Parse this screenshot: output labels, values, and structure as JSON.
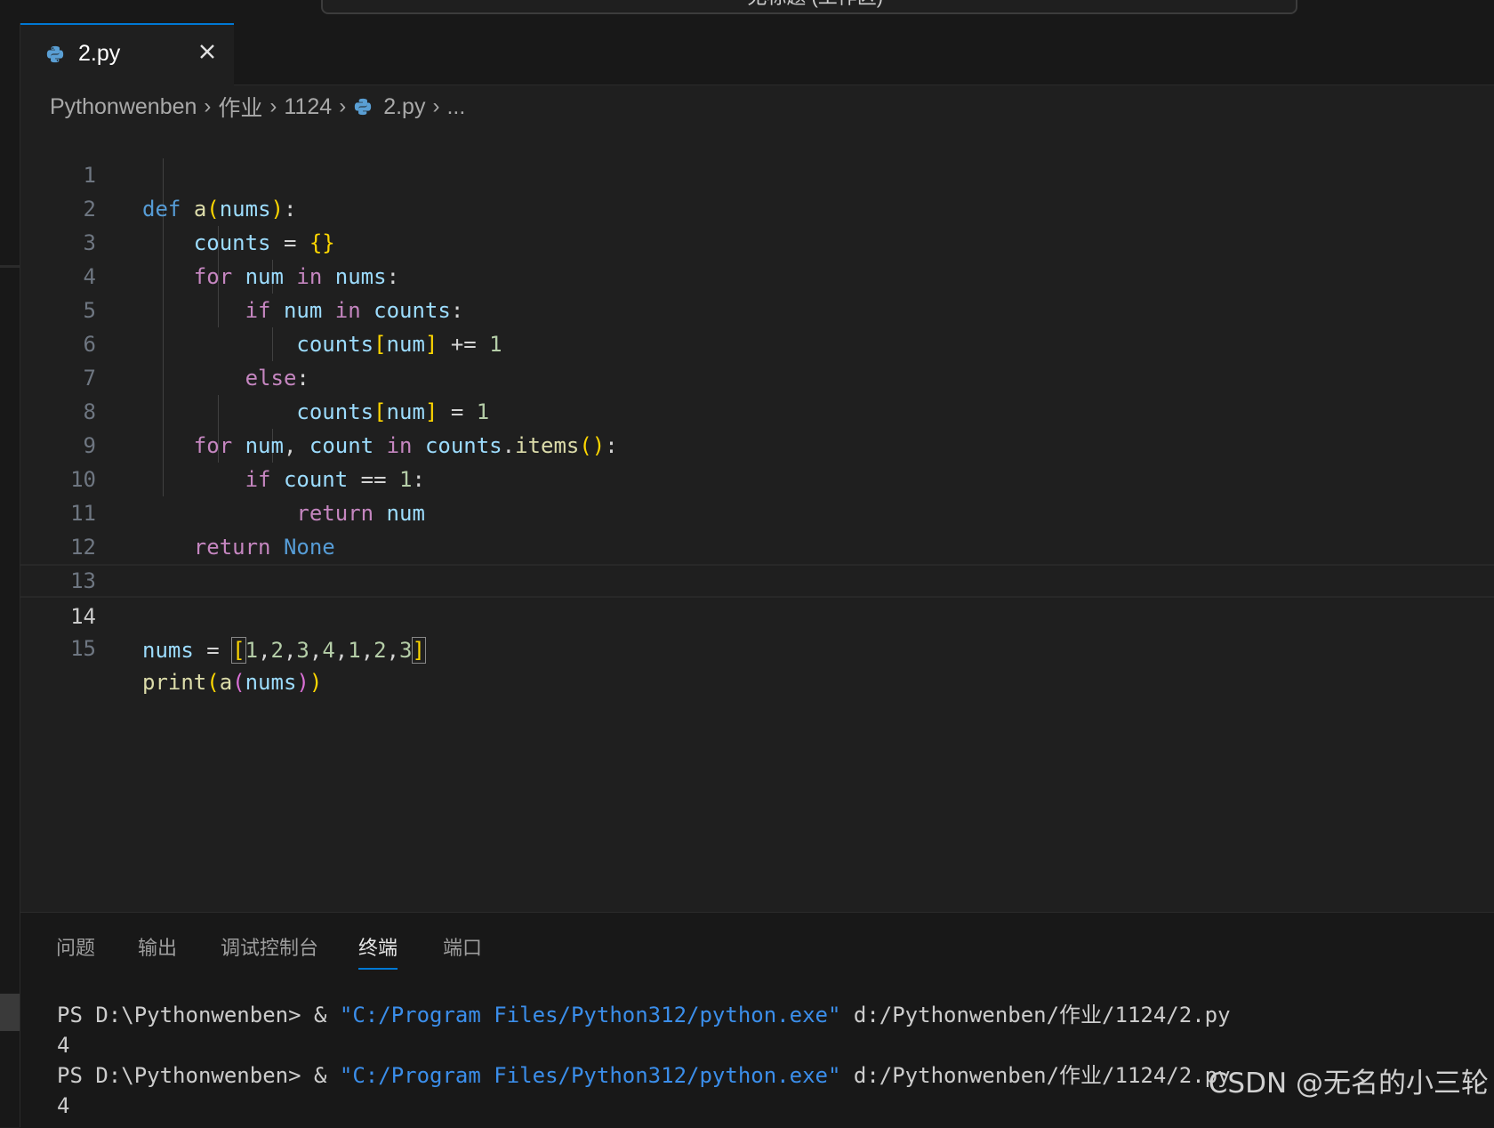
{
  "title_bar": {
    "text": "- 无标题 (工作区)"
  },
  "tab": {
    "label": "2.py"
  },
  "breadcrumb": {
    "items": [
      "Pythonwenben",
      "作业",
      "1124",
      "2.py",
      "..."
    ]
  },
  "editor": {
    "active_line": 14,
    "lines": [
      {
        "n": "1"
      },
      {
        "n": "2"
      },
      {
        "n": "3"
      },
      {
        "n": "4"
      },
      {
        "n": "5"
      },
      {
        "n": "6"
      },
      {
        "n": "7"
      },
      {
        "n": "8"
      },
      {
        "n": "9"
      },
      {
        "n": "10"
      },
      {
        "n": "11"
      },
      {
        "n": "12"
      },
      {
        "n": "13"
      },
      {
        "n": "14"
      },
      {
        "n": "15"
      }
    ]
  },
  "panel": {
    "tabs": [
      "问题",
      "输出",
      "调试控制台",
      "终端",
      "端口"
    ],
    "active_tab": "终端"
  },
  "terminal": {
    "prompt": "PS D:\\Pythonwenben> & ",
    "exe": "\"C:/Program Files/Python312/python.exe\"",
    "script": " d:/Pythonwenben/作业/1124/2.py",
    "output": "4"
  },
  "watermark": "CSDN @无名的小三轮",
  "colors": {
    "editor_bg": "#1f1f1f",
    "accent": "#0078d4",
    "keyword": "#c586c0",
    "variable": "#9cdcfe",
    "function": "#dcdcaa",
    "number": "#b5cea8"
  }
}
